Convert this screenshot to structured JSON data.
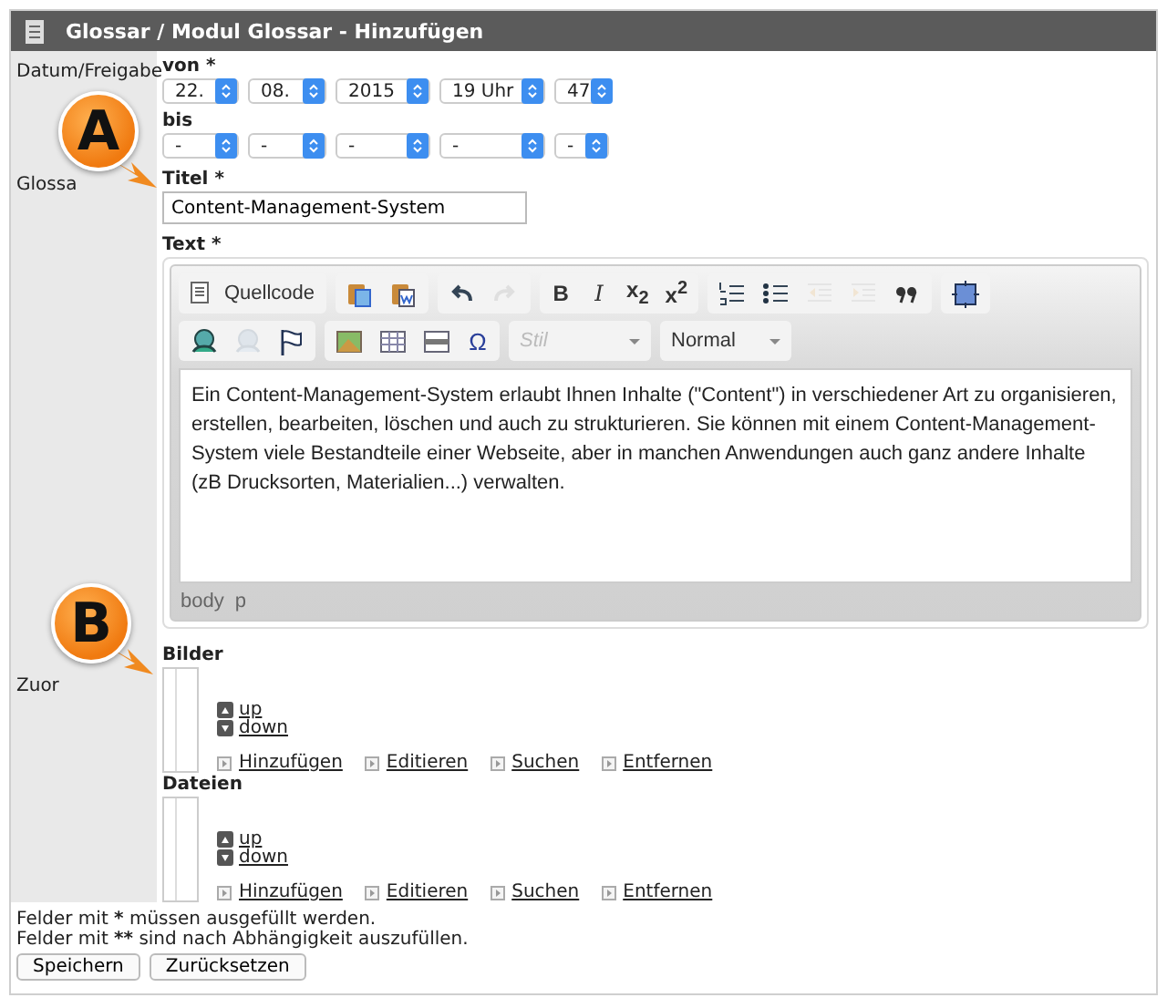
{
  "header": {
    "title": "Glossar / Modul Glossar - Hinzufügen"
  },
  "rows": [
    {
      "kind": "dates",
      "label": "Datum/Freigabe",
      "ranges": [
        {
          "label": "von *",
          "selects": [
            "22.",
            "08.",
            "2015",
            "19 Uhr",
            "47"
          ]
        },
        {
          "label": "bis",
          "selects": [
            "-",
            "-",
            "-",
            "-",
            "-"
          ]
        }
      ]
    },
    {
      "kind": "content",
      "label": "Glossa",
      "callout": "A",
      "title": {
        "label": "Titel *",
        "value": "Content-Management-System"
      },
      "text": {
        "label": "Text *",
        "toolbar": [
          [
            [
              {
                "kind": "source",
                "label": "Quellcode",
                "disabled": false
              }
            ],
            [
              {
                "kind": "paste",
                "disabled": false
              },
              {
                "kind": "paste_word",
                "disabled": false
              }
            ],
            [
              {
                "kind": "undo",
                "disabled": false
              },
              {
                "kind": "redo",
                "disabled": true
              }
            ],
            [
              {
                "kind": "bold",
                "label": "B",
                "disabled": false
              },
              {
                "kind": "italic",
                "label": "I",
                "disabled": false
              },
              {
                "kind": "script",
                "label": "x$_{2}$",
                "disabled": false
              },
              {
                "kind": "script",
                "label": "x$^{2}$",
                "disabled": false
              }
            ],
            [
              {
                "kind": "numbered_list",
                "disabled": false
              },
              {
                "kind": "bullet_list",
                "disabled": false
              },
              {
                "kind": "outdent",
                "disabled": true
              },
              {
                "kind": "indent",
                "disabled": true
              },
              {
                "kind": "quote",
                "disabled": false
              }
            ],
            [
              {
                "kind": "maximize",
                "disabled": false
              }
            ]
          ],
          [
            [
              {
                "kind": "link",
                "disabled": false
              },
              {
                "kind": "unlink",
                "disabled": true
              },
              {
                "kind": "anchor",
                "disabled": false
              }
            ],
            [
              {
                "kind": "image",
                "disabled": false
              },
              {
                "kind": "table",
                "disabled": false
              },
              {
                "kind": "rule",
                "disabled": false
              },
              {
                "kind": "symbol",
                "label": "Ω",
                "disabled": false
              }
            ],
            [
              {
                "kind": "select",
                "placeholder": "Stil",
                "disabled": true
              },
              {
                "kind": "select",
                "value": "Normal",
                "disabled": false
              }
            ]
          ]
        ],
        "body": "Ein Content-Management-System erlaubt Ihnen Inhalte (\"Content\") in verschiedener Art zu organisieren, erstellen, bearbeiten, löschen und auch zu strukturieren. Sie können mit einem Content-Management-System viele Bestandteile einer Webseite, aber in manchen Anwendungen auch ganz andere Inhalte (zB Drucksorten, Materialien...) verwalten.",
        "path": [
          "body",
          "p"
        ]
      }
    },
    {
      "kind": "attachments",
      "label": "Zuor",
      "callout": "B",
      "lists": [
        {
          "label": "Bilder",
          "move": [
            "up",
            "down"
          ],
          "actions": [
            "Hinzufügen",
            "Editieren",
            "Suchen",
            "Entfernen"
          ]
        },
        {
          "label": "Dateien",
          "move": [
            "up",
            "down"
          ],
          "actions": [
            "Hinzufügen",
            "Editieren",
            "Suchen",
            "Entfernen"
          ]
        }
      ]
    }
  ],
  "notes": [
    {
      "before": "Felder mit",
      "mark": "*",
      "after": "müssen ausgefüllt werden."
    },
    {
      "before": "Felder mit",
      "mark": "**",
      "after": "sind nach Abhängigkeit auszufüllen."
    }
  ],
  "buttons": [
    "Speichern",
    "Zurücksetzen"
  ]
}
